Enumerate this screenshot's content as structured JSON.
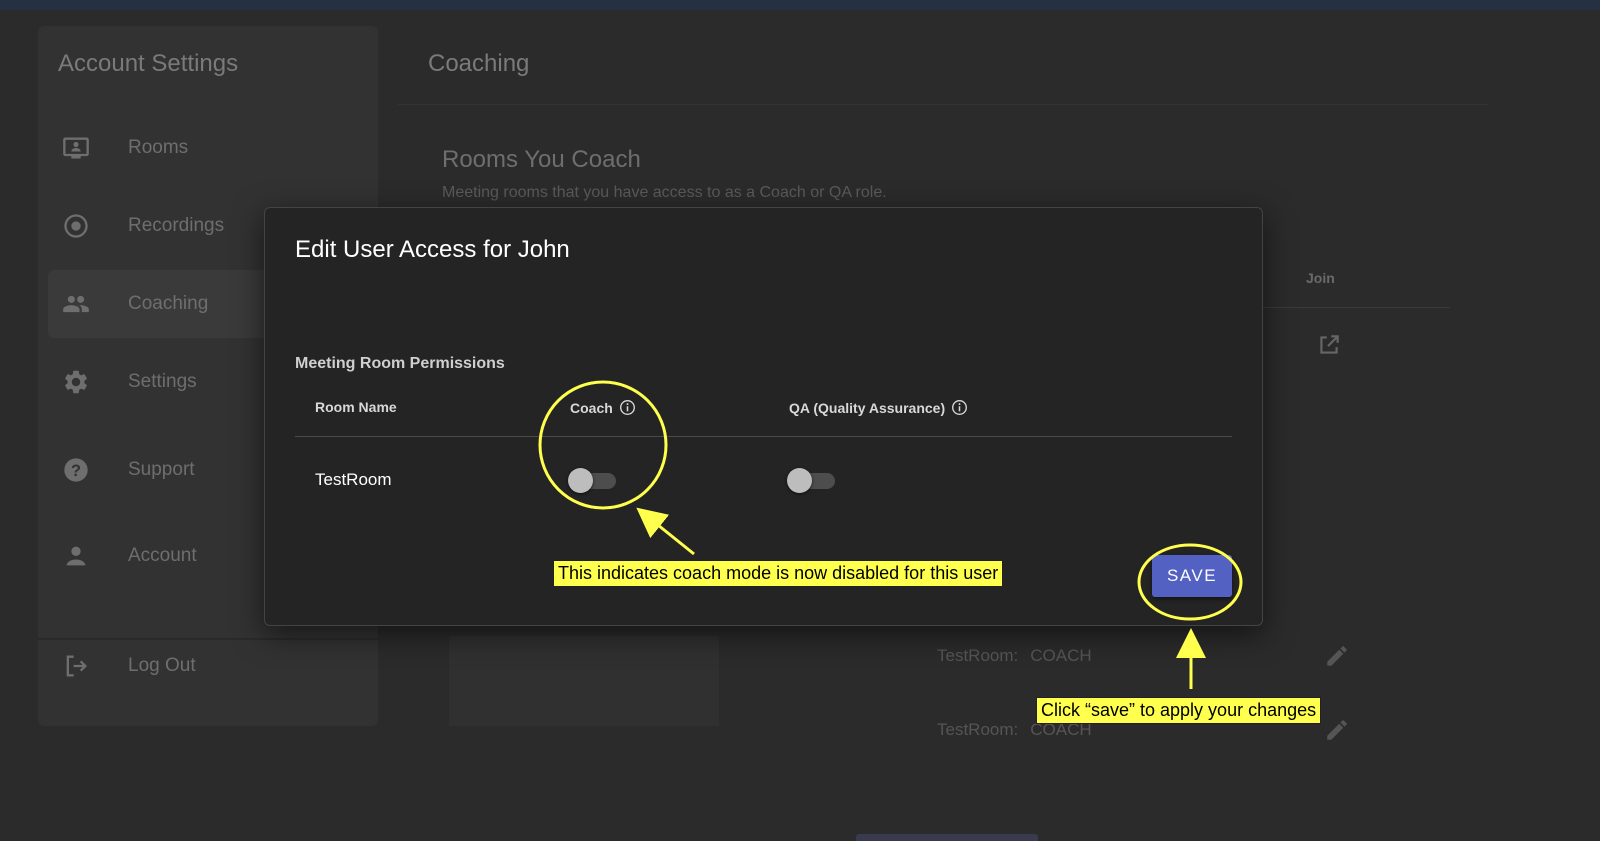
{
  "sidebar": {
    "title": "Account Settings",
    "items": [
      {
        "label": "Rooms",
        "icon": "monitor-icon"
      },
      {
        "label": "Recordings",
        "icon": "record-icon"
      },
      {
        "label": "Coaching",
        "icon": "people-icon"
      },
      {
        "label": "Settings",
        "icon": "gear-icon"
      },
      {
        "label": "Support",
        "icon": "help-icon"
      },
      {
        "label": "Account",
        "icon": "person-icon"
      }
    ],
    "logout": {
      "label": "Log Out",
      "icon": "logout-icon"
    }
  },
  "main": {
    "title": "Coaching",
    "rooms_section": {
      "title": "Rooms You Coach",
      "subtitle": "Meeting rooms that you have access to as a Coach or QA role.",
      "join_header": "Join"
    },
    "assignments": [
      {
        "room": "TestRoom:",
        "role": "COACH"
      },
      {
        "room": "TestRoom:",
        "role": "COACH"
      }
    ]
  },
  "modal": {
    "title": "Edit User Access for John",
    "permissions_title": "Meeting Room Permissions",
    "columns": {
      "room_name": "Room Name",
      "coach": "Coach",
      "qa": "QA (Quality Assurance)"
    },
    "rows": [
      {
        "room_name": "TestRoom",
        "coach_enabled": false,
        "qa_enabled": false
      }
    ],
    "save_label": "SAVE"
  },
  "annotations": {
    "coach_note": "This indicates coach mode is now disabled for this user",
    "save_note": "Click “save” to apply your changes"
  },
  "colors": {
    "annotation": "#ffff4d",
    "save_button": "#5361c3"
  }
}
